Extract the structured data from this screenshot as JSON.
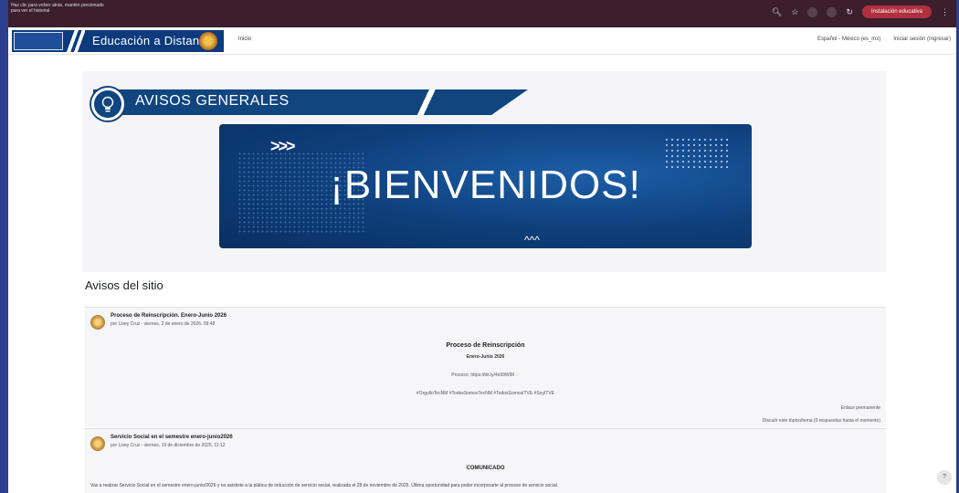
{
  "browser": {
    "tooltip_line1": "Haz clic para volver atrás, mantén presionado",
    "tooltip_line2": "para ver el historial",
    "extension_button": "Instalación educativa"
  },
  "navbar": {
    "brand_title": "Educación a Distancia",
    "inicio": "Inicio",
    "language": "Español - México (es_mx)",
    "login": "Iniciar sesión (Ingresar)"
  },
  "hero": {
    "avisos_title": "AVISOS GENERALES",
    "chevrons": ">>>",
    "welcome": "¡BIENVENIDOS!",
    "mini_chevron": "^^^"
  },
  "site_news": {
    "title": "Avisos del sitio",
    "posts": [
      {
        "title": "Proceso de Reinscripción. Enero-Junio 2026",
        "meta": "por Livey Cruz - viernes, 2 de enero de 2026, 09:48",
        "heading": "Proceso de Reinscripción",
        "subheading": "Enero-Junio 2026",
        "link_line": "Proceso: https://bit.ly/4s99WiM ",
        "hashtags": "#OrgulloTecNM #TodosSomosTecNM #TodosSomosITVE #SoyITVE",
        "permalink": "Enlace permanente",
        "discuss": "Discutir este tópico/tema (0 respuestas hasta el momento)"
      },
      {
        "title": "Servicio Social en el semestre enero-junio2026",
        "meta": "por Livey Cruz - viernes, 19 de diciembre de 2025, 11:12",
        "heading": "COMUNICADO",
        "body": "Vas a realizar Servicio Social en el semestre enero-junio/2026 y no asististe a la plática de inducción de servicio social, realizada el 28 de noviembre de 2025. Última oportunidad para poder incorporarte al proceso de servicio social."
      }
    ]
  },
  "help": {
    "label": "?"
  },
  "colors": {
    "brand_blue": "#0c3a7d",
    "chrome": "#3b1f2d",
    "accent_red": "#b1303f"
  }
}
